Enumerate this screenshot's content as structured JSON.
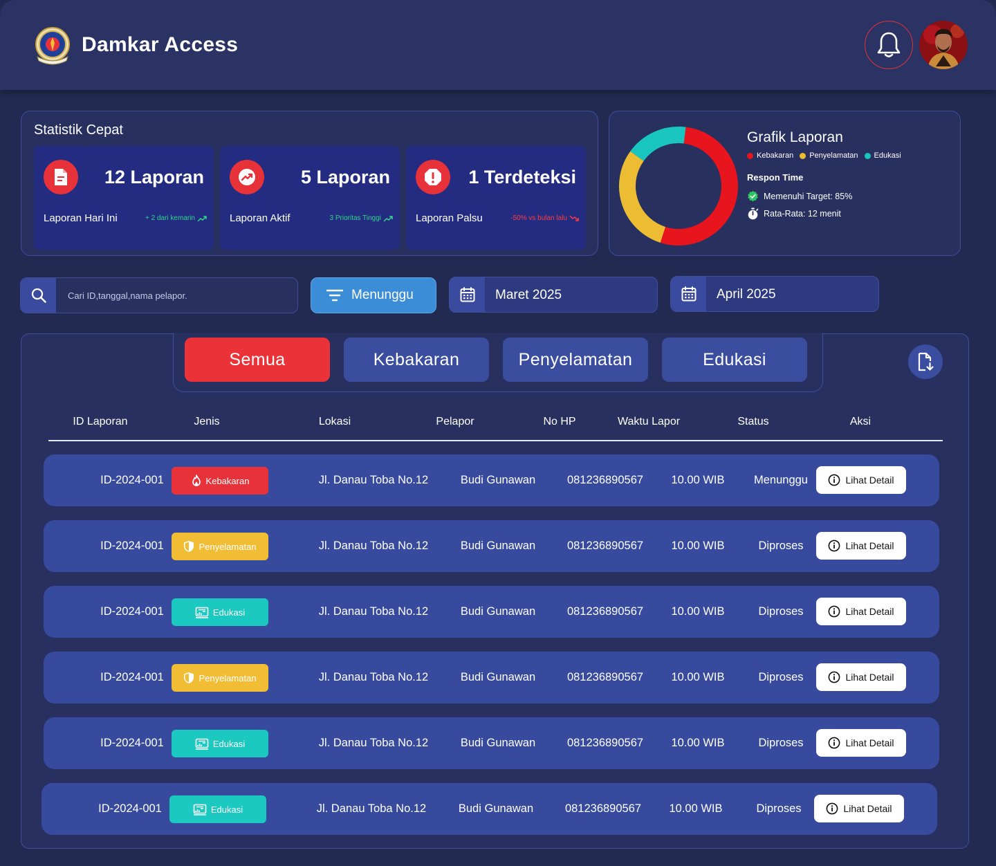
{
  "app": {
    "title": "Damkar Access",
    "logo_icon": "damkar-emblem-logo",
    "notification_icon": "bell-icon",
    "avatar_icon": "user-avatar"
  },
  "stats": {
    "title": "Statistik Cepat",
    "cards": [
      {
        "icon": "document-icon",
        "value": "12 Laporan",
        "label": "Laporan Hari Ini",
        "delta": "+ 2 dari kemarin",
        "trend": "up",
        "trend_color": "#34d58a"
      },
      {
        "icon": "trending-up-icon",
        "value": "5 Laporan",
        "label": "Laporan Aktif",
        "delta": "3 Prioritas Tinggi",
        "trend": "up",
        "trend_color": "#34d58a"
      },
      {
        "icon": "alert-icon",
        "value": "1 Terdeteksi",
        "label": "Laporan Palsu",
        "delta": "-50% vs bulan lalu",
        "trend": "down",
        "trend_color": "#ff3b45"
      }
    ]
  },
  "chart_panel": {
    "title": "Grafik Laporan",
    "respon_title": "Respon Time",
    "respon_items": [
      {
        "icon": "check-badge-icon",
        "text": "Memenuhi Target: 85%"
      },
      {
        "icon": "stopwatch-icon",
        "text": "Rata-Rata: 12 menit"
      }
    ]
  },
  "chart_data": {
    "type": "pie",
    "style": "donut",
    "title": "Grafik Laporan",
    "categories": [
      "Kebakaran",
      "Penyelamatan",
      "Edukasi"
    ],
    "values": [
      53,
      30,
      17
    ],
    "colors": [
      "#e8141e",
      "#ecbd33",
      "#18c6bf"
    ],
    "legend": "top"
  },
  "filters": {
    "search_placeholder": "Cari ID,tanggal,nama pelapor.",
    "status_filter": "Menunggu",
    "date_from": "Maret 2025",
    "date_to": "April 2025"
  },
  "tabs": [
    {
      "label": "Semua",
      "active": true
    },
    {
      "label": "Kebakaran",
      "active": false
    },
    {
      "label": "Penyelamatan",
      "active": false
    },
    {
      "label": "Edukasi",
      "active": false
    }
  ],
  "table": {
    "columns": [
      "ID Laporan",
      "Jenis",
      "Lokasi",
      "Pelapor",
      "No HP",
      "Waktu Lapor",
      "Status",
      "Aksi"
    ],
    "detail_label": "Lihat Detail",
    "rows": [
      {
        "id": "ID-2024-001",
        "jenis": "Kebakaran",
        "jenis_key": "kebakaran",
        "lokasi": "Jl. Danau Toba No.12",
        "pelapor": "Budi Gunawan",
        "hp": "081236890567",
        "waktu": "10.00 WIB",
        "status": "Menunggu"
      },
      {
        "id": "ID-2024-001",
        "jenis": "Penyelamatan",
        "jenis_key": "penyelamatan",
        "lokasi": "Jl. Danau Toba No.12",
        "pelapor": "Budi Gunawan",
        "hp": "081236890567",
        "waktu": "10.00 WIB",
        "status": "Diproses"
      },
      {
        "id": "ID-2024-001",
        "jenis": "Edukasi",
        "jenis_key": "edukasi",
        "lokasi": "Jl. Danau Toba No.12",
        "pelapor": "Budi Gunawan",
        "hp": "081236890567",
        "waktu": "10.00 WIB",
        "status": "Diproses"
      },
      {
        "id": "ID-2024-001",
        "jenis": "Penyelamatan",
        "jenis_key": "penyelamatan",
        "lokasi": "Jl. Danau Toba No.12",
        "pelapor": "Budi Gunawan",
        "hp": "081236890567",
        "waktu": "10.00 WIB",
        "status": "Diproses"
      },
      {
        "id": "ID-2024-001",
        "jenis": "Edukasi",
        "jenis_key": "edukasi",
        "lokasi": "Jl. Danau Toba No.12",
        "pelapor": "Budi Gunawan",
        "hp": "081236890567",
        "waktu": "10.00 WIB",
        "status": "Diproses"
      },
      {
        "id": "ID-2024-001",
        "jenis": "Edukasi",
        "jenis_key": "edukasi",
        "lokasi": "Jl. Danau Toba No.12",
        "pelapor": "Budi Gunawan",
        "hp": "081236890567",
        "waktu": "10.00 WIB",
        "status": "Diproses"
      }
    ]
  }
}
